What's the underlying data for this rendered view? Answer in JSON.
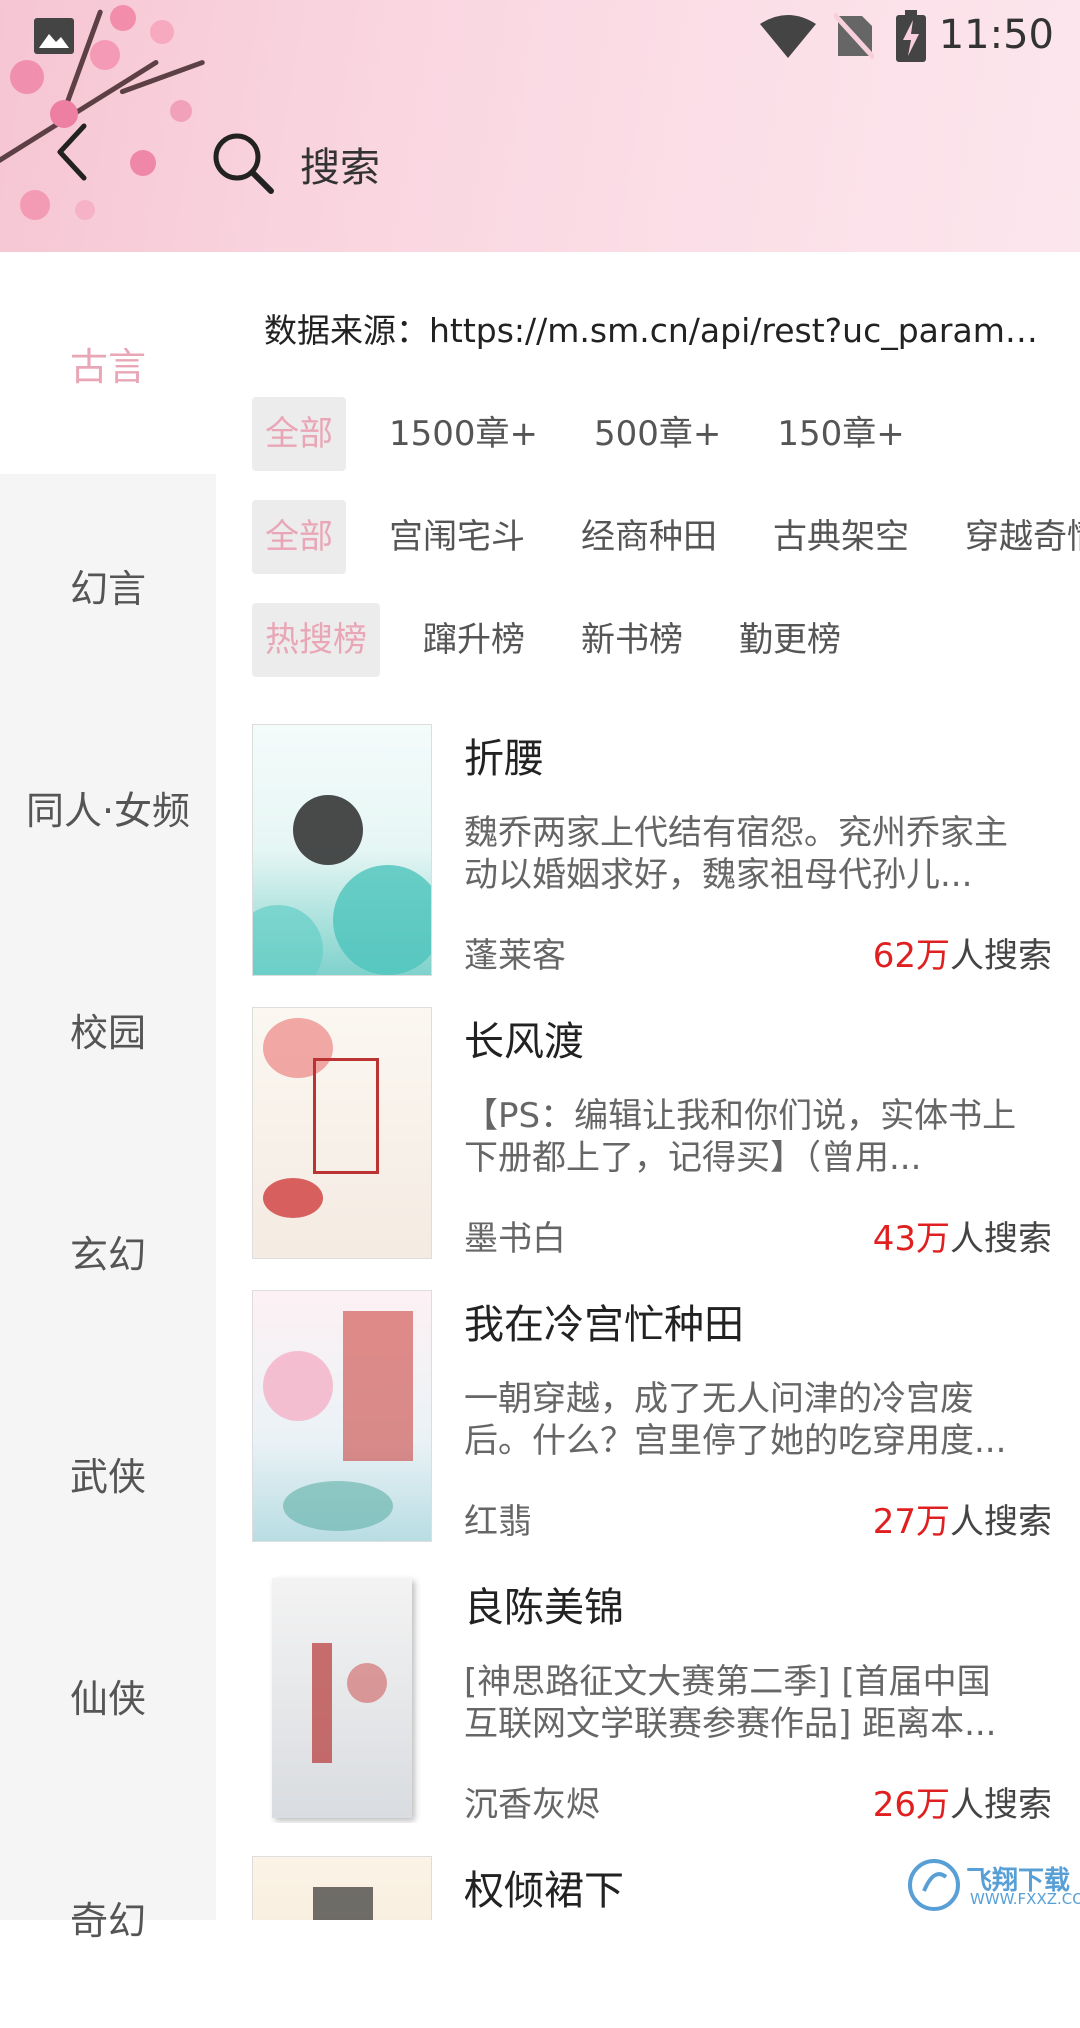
{
  "status_bar": {
    "time": "11:50"
  },
  "search": {
    "placeholder": "搜索"
  },
  "sidebar": {
    "items": [
      {
        "label": "古言",
        "active": true
      },
      {
        "label": "幻言"
      },
      {
        "label": "同人·女频"
      },
      {
        "label": "校园"
      },
      {
        "label": "玄幻"
      },
      {
        "label": "武侠"
      },
      {
        "label": "仙侠"
      },
      {
        "label": "奇幻"
      }
    ]
  },
  "source_text": "数据来源：https://m.sm.cn/api/rest?uc_param_str=dnntnwvepffrgibijbprsvdsdichei",
  "filters": {
    "length": [
      "全部",
      "1500章+",
      "500章+",
      "150章+"
    ],
    "category": [
      "全部",
      "宫闱宅斗",
      "经商种田",
      "古典架空",
      "穿越奇情"
    ],
    "ranking": [
      "热搜榜",
      "蹿升榜",
      "新书榜",
      "勤更榜"
    ]
  },
  "books": [
    {
      "title": "折腰",
      "desc": "魏乔两家上代结有宿怨。兖州乔家主动以婚姻求好，魏家祖母代孙儿...",
      "author": "蓬莱客",
      "count": "62万",
      "suffix": "人搜索"
    },
    {
      "title": "长风渡",
      "desc": "【PS：编辑让我和你们说，实体书上下册都上了，记得买】（曾用...",
      "author": "墨书白",
      "count": "43万",
      "suffix": "人搜索"
    },
    {
      "title": "我在冷宫忙种田",
      "desc": "一朝穿越，成了无人问津的冷宫废后。什么？宫里停了她的吃穿用度...",
      "author": "红翡",
      "count": "27万",
      "suffix": "人搜索"
    },
    {
      "title": "良陈美锦",
      "desc": "[神思路征文大赛第二季] [首届中国互联网文学联赛参赛作品] 距离本...",
      "author": "沉香灰烬",
      "count": "26万",
      "suffix": "人搜索"
    },
    {
      "title": "权倾裙下"
    }
  ],
  "watermark": {
    "brand": "飞翔下载",
    "url": "WWW.FXXZ.COM"
  },
  "colors": {
    "accent": "#e9a6b6",
    "count_red": "#e02020",
    "sidebar_bg": "#f5f5f5"
  }
}
